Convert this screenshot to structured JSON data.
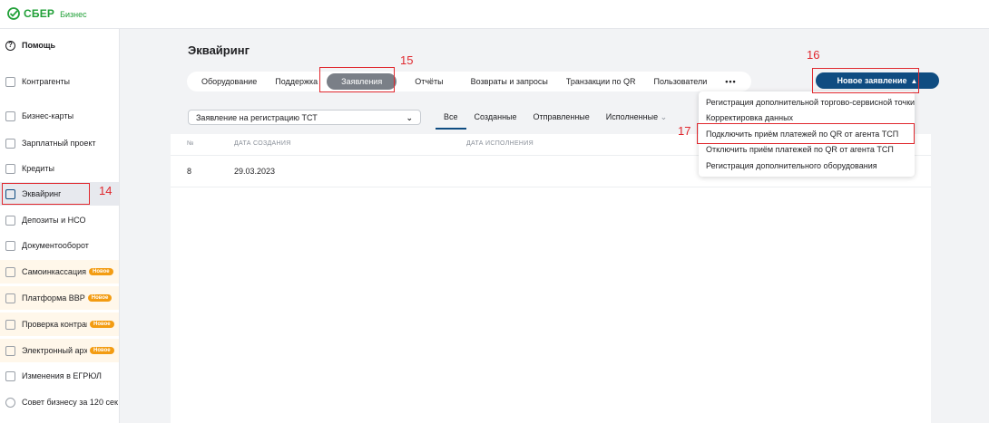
{
  "brand": {
    "name": "СБЕР",
    "sub": "Бизнес",
    "color": "#21a038"
  },
  "sidebar": {
    "items": [
      {
        "label": "Помощь",
        "icon": "help-circle-icon"
      },
      {
        "label": "Контрагенты",
        "icon": "contacts-icon"
      },
      {
        "label": "Бизнес-карты",
        "icon": "card-icon"
      },
      {
        "label": "Зарплатный проект",
        "icon": "salary-icon"
      },
      {
        "label": "Кредиты",
        "icon": "credit-icon"
      },
      {
        "label": "Эквайринг",
        "icon": "acquiring-icon"
      },
      {
        "label": "Депозиты и НСО",
        "icon": "deposit-icon"
      },
      {
        "label": "Документооборот",
        "icon": "document-icon"
      },
      {
        "label": "Самоинкассация",
        "icon": "cash-icon",
        "badge": "Новое"
      },
      {
        "label": "Платформа ВВР",
        "icon": "platform-icon",
        "badge": "Новое"
      },
      {
        "label": "Проверка контраг",
        "icon": "check-icon",
        "badge": "Новое"
      },
      {
        "label": "Электронный архи",
        "icon": "cloud-icon",
        "badge": "Новое"
      },
      {
        "label": "Изменения в ЕГРЮЛ",
        "icon": "registry-icon"
      },
      {
        "label": "Совет бизнесу за 120 сек",
        "icon": "clock-icon"
      }
    ]
  },
  "page": {
    "title": "Эквайринг",
    "tabs": [
      "Оборудование",
      "Поддержка",
      "Заявления",
      "Отчёты",
      "Возвраты и запросы",
      "Транзакции по QR",
      "Пользователи",
      "•••"
    ],
    "new_button": "Новое заявление",
    "select_value": "Заявление на регистрацию ТСТ",
    "filters": [
      "Все",
      "Созданные",
      "Отправленные",
      "Исполненные"
    ],
    "table": {
      "headers": [
        "№",
        "ДАТА СОЗДАНИЯ",
        "ДАТА ИСПОЛНЕНИЯ"
      ],
      "rows": [
        {
          "num": "8",
          "created": "29.03.2023"
        }
      ]
    }
  },
  "dropdown": {
    "items": [
      "Регистрация дополнительной торгово-сервисной точки",
      "Корректировка данных",
      "Подключить приём платежей по QR от агента ТСП",
      "Отключить приём платежей по QR от агента ТСП",
      "Регистрация дополнительного оборудования"
    ]
  },
  "annotations": {
    "a14": "14",
    "a15": "15",
    "a16": "16",
    "a17": "17",
    "color": "#e0282e"
  }
}
